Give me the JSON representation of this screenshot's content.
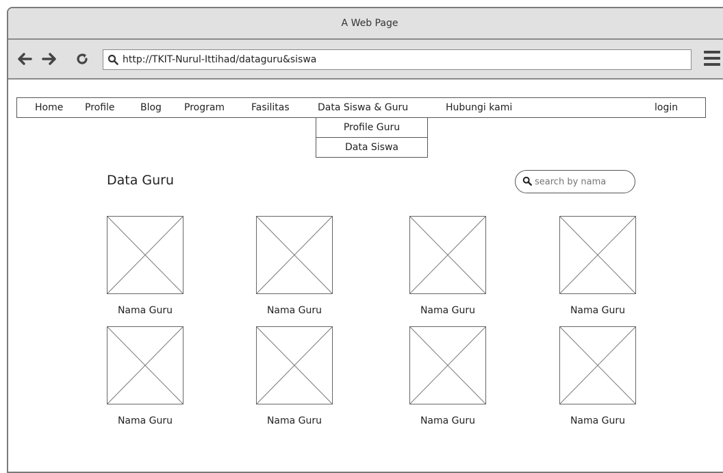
{
  "window": {
    "title": "A Web Page"
  },
  "toolbar": {
    "back_icon": "arrow-left",
    "forward_icon": "arrow-right",
    "reload_icon": "reload",
    "url": "http://TKIT-Nurul-Ittihad/dataguru&siswa",
    "menu_icon": "hamburger"
  },
  "nav": {
    "items": [
      "Home",
      "Profile",
      "Blog",
      "Program",
      "Fasilitas",
      "Data Siswa & Guru",
      "Hubungi kami"
    ],
    "login": "login",
    "dropdown": [
      "Profile Guru",
      "Data Siswa"
    ]
  },
  "main": {
    "title": "Data Guru",
    "search_placeholder": "search by nama",
    "cards": [
      {
        "name": "Nama Guru"
      },
      {
        "name": "Nama Guru"
      },
      {
        "name": "Nama Guru"
      },
      {
        "name": "Nama Guru"
      },
      {
        "name": "Nama Guru"
      },
      {
        "name": "Nama Guru"
      },
      {
        "name": "Nama Guru"
      },
      {
        "name": "Nama Guru"
      }
    ]
  },
  "colors": {
    "chrome": "#e1e1e1",
    "border": "#555555",
    "text": "#222222"
  }
}
